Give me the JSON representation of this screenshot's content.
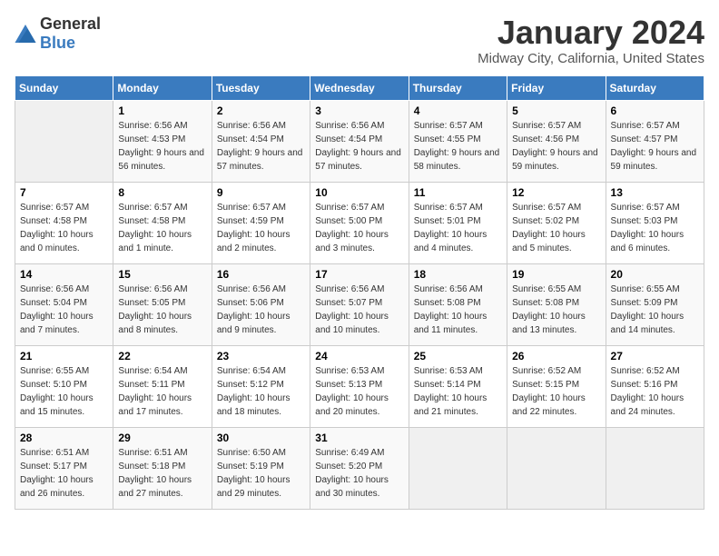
{
  "logo": {
    "text_general": "General",
    "text_blue": "Blue"
  },
  "title": "January 2024",
  "location": "Midway City, California, United States",
  "headers": [
    "Sunday",
    "Monday",
    "Tuesday",
    "Wednesday",
    "Thursday",
    "Friday",
    "Saturday"
  ],
  "weeks": [
    [
      {
        "day": "",
        "sunrise": "",
        "sunset": "",
        "daylight": ""
      },
      {
        "day": "1",
        "sunrise": "Sunrise: 6:56 AM",
        "sunset": "Sunset: 4:53 PM",
        "daylight": "Daylight: 9 hours and 56 minutes."
      },
      {
        "day": "2",
        "sunrise": "Sunrise: 6:56 AM",
        "sunset": "Sunset: 4:54 PM",
        "daylight": "Daylight: 9 hours and 57 minutes."
      },
      {
        "day": "3",
        "sunrise": "Sunrise: 6:56 AM",
        "sunset": "Sunset: 4:54 PM",
        "daylight": "Daylight: 9 hours and 57 minutes."
      },
      {
        "day": "4",
        "sunrise": "Sunrise: 6:57 AM",
        "sunset": "Sunset: 4:55 PM",
        "daylight": "Daylight: 9 hours and 58 minutes."
      },
      {
        "day": "5",
        "sunrise": "Sunrise: 6:57 AM",
        "sunset": "Sunset: 4:56 PM",
        "daylight": "Daylight: 9 hours and 59 minutes."
      },
      {
        "day": "6",
        "sunrise": "Sunrise: 6:57 AM",
        "sunset": "Sunset: 4:57 PM",
        "daylight": "Daylight: 9 hours and 59 minutes."
      }
    ],
    [
      {
        "day": "7",
        "sunrise": "Sunrise: 6:57 AM",
        "sunset": "Sunset: 4:58 PM",
        "daylight": "Daylight: 10 hours and 0 minutes."
      },
      {
        "day": "8",
        "sunrise": "Sunrise: 6:57 AM",
        "sunset": "Sunset: 4:58 PM",
        "daylight": "Daylight: 10 hours and 1 minute."
      },
      {
        "day": "9",
        "sunrise": "Sunrise: 6:57 AM",
        "sunset": "Sunset: 4:59 PM",
        "daylight": "Daylight: 10 hours and 2 minutes."
      },
      {
        "day": "10",
        "sunrise": "Sunrise: 6:57 AM",
        "sunset": "Sunset: 5:00 PM",
        "daylight": "Daylight: 10 hours and 3 minutes."
      },
      {
        "day": "11",
        "sunrise": "Sunrise: 6:57 AM",
        "sunset": "Sunset: 5:01 PM",
        "daylight": "Daylight: 10 hours and 4 minutes."
      },
      {
        "day": "12",
        "sunrise": "Sunrise: 6:57 AM",
        "sunset": "Sunset: 5:02 PM",
        "daylight": "Daylight: 10 hours and 5 minutes."
      },
      {
        "day": "13",
        "sunrise": "Sunrise: 6:57 AM",
        "sunset": "Sunset: 5:03 PM",
        "daylight": "Daylight: 10 hours and 6 minutes."
      }
    ],
    [
      {
        "day": "14",
        "sunrise": "Sunrise: 6:56 AM",
        "sunset": "Sunset: 5:04 PM",
        "daylight": "Daylight: 10 hours and 7 minutes."
      },
      {
        "day": "15",
        "sunrise": "Sunrise: 6:56 AM",
        "sunset": "Sunset: 5:05 PM",
        "daylight": "Daylight: 10 hours and 8 minutes."
      },
      {
        "day": "16",
        "sunrise": "Sunrise: 6:56 AM",
        "sunset": "Sunset: 5:06 PM",
        "daylight": "Daylight: 10 hours and 9 minutes."
      },
      {
        "day": "17",
        "sunrise": "Sunrise: 6:56 AM",
        "sunset": "Sunset: 5:07 PM",
        "daylight": "Daylight: 10 hours and 10 minutes."
      },
      {
        "day": "18",
        "sunrise": "Sunrise: 6:56 AM",
        "sunset": "Sunset: 5:08 PM",
        "daylight": "Daylight: 10 hours and 11 minutes."
      },
      {
        "day": "19",
        "sunrise": "Sunrise: 6:55 AM",
        "sunset": "Sunset: 5:08 PM",
        "daylight": "Daylight: 10 hours and 13 minutes."
      },
      {
        "day": "20",
        "sunrise": "Sunrise: 6:55 AM",
        "sunset": "Sunset: 5:09 PM",
        "daylight": "Daylight: 10 hours and 14 minutes."
      }
    ],
    [
      {
        "day": "21",
        "sunrise": "Sunrise: 6:55 AM",
        "sunset": "Sunset: 5:10 PM",
        "daylight": "Daylight: 10 hours and 15 minutes."
      },
      {
        "day": "22",
        "sunrise": "Sunrise: 6:54 AM",
        "sunset": "Sunset: 5:11 PM",
        "daylight": "Daylight: 10 hours and 17 minutes."
      },
      {
        "day": "23",
        "sunrise": "Sunrise: 6:54 AM",
        "sunset": "Sunset: 5:12 PM",
        "daylight": "Daylight: 10 hours and 18 minutes."
      },
      {
        "day": "24",
        "sunrise": "Sunrise: 6:53 AM",
        "sunset": "Sunset: 5:13 PM",
        "daylight": "Daylight: 10 hours and 20 minutes."
      },
      {
        "day": "25",
        "sunrise": "Sunrise: 6:53 AM",
        "sunset": "Sunset: 5:14 PM",
        "daylight": "Daylight: 10 hours and 21 minutes."
      },
      {
        "day": "26",
        "sunrise": "Sunrise: 6:52 AM",
        "sunset": "Sunset: 5:15 PM",
        "daylight": "Daylight: 10 hours and 22 minutes."
      },
      {
        "day": "27",
        "sunrise": "Sunrise: 6:52 AM",
        "sunset": "Sunset: 5:16 PM",
        "daylight": "Daylight: 10 hours and 24 minutes."
      }
    ],
    [
      {
        "day": "28",
        "sunrise": "Sunrise: 6:51 AM",
        "sunset": "Sunset: 5:17 PM",
        "daylight": "Daylight: 10 hours and 26 minutes."
      },
      {
        "day": "29",
        "sunrise": "Sunrise: 6:51 AM",
        "sunset": "Sunset: 5:18 PM",
        "daylight": "Daylight: 10 hours and 27 minutes."
      },
      {
        "day": "30",
        "sunrise": "Sunrise: 6:50 AM",
        "sunset": "Sunset: 5:19 PM",
        "daylight": "Daylight: 10 hours and 29 minutes."
      },
      {
        "day": "31",
        "sunrise": "Sunrise: 6:49 AM",
        "sunset": "Sunset: 5:20 PM",
        "daylight": "Daylight: 10 hours and 30 minutes."
      },
      {
        "day": "",
        "sunrise": "",
        "sunset": "",
        "daylight": ""
      },
      {
        "day": "",
        "sunrise": "",
        "sunset": "",
        "daylight": ""
      },
      {
        "day": "",
        "sunrise": "",
        "sunset": "",
        "daylight": ""
      }
    ]
  ]
}
